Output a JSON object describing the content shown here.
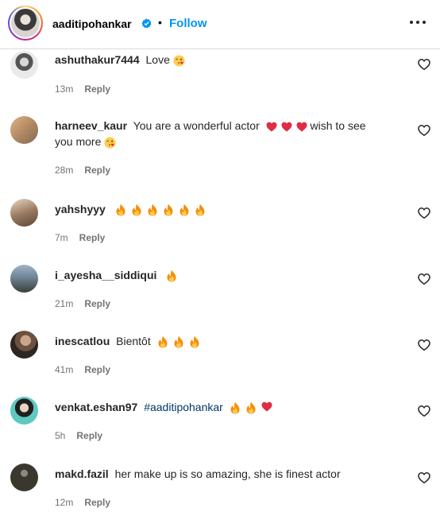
{
  "header": {
    "username": "aaditipohankar",
    "follow_label": "Follow",
    "separator": "•"
  },
  "comments": [
    {
      "username": "ashuthakur7444",
      "text": "Love",
      "time": "13m",
      "reply": "Reply"
    },
    {
      "username": "harneev_kaur",
      "text": "You are a wonderful actor",
      "text2": "wish to see",
      "text3": "you more",
      "time": "28m",
      "reply": "Reply"
    },
    {
      "username": "yahshyyy",
      "text": "",
      "time": "7m",
      "reply": "Reply"
    },
    {
      "username": "i_ayesha__siddiqui",
      "text": "",
      "time": "21m",
      "reply": "Reply"
    },
    {
      "username": "inescatlou",
      "text": "Bientôt",
      "time": "41m",
      "reply": "Reply"
    },
    {
      "username": "venkat.eshan97",
      "text": "#aaditipohankar",
      "time": "5h",
      "reply": "Reply"
    },
    {
      "username": "makd.fazil",
      "text": "her make up is so amazing, she is finest actor",
      "time": "12m",
      "reply": "Reply"
    }
  ],
  "icons": {
    "verified": "verified-badge-icon",
    "more": "more-options-icon",
    "like": "heart-outline-icon",
    "fire": "fire-emoji",
    "red_heart": "red-heart-emoji",
    "kiss": "face-blowing-kiss-emoji"
  },
  "colors": {
    "follow": "#0095f6",
    "verified": "#0095f6",
    "mention": "#00376b",
    "meta": "#737373"
  }
}
